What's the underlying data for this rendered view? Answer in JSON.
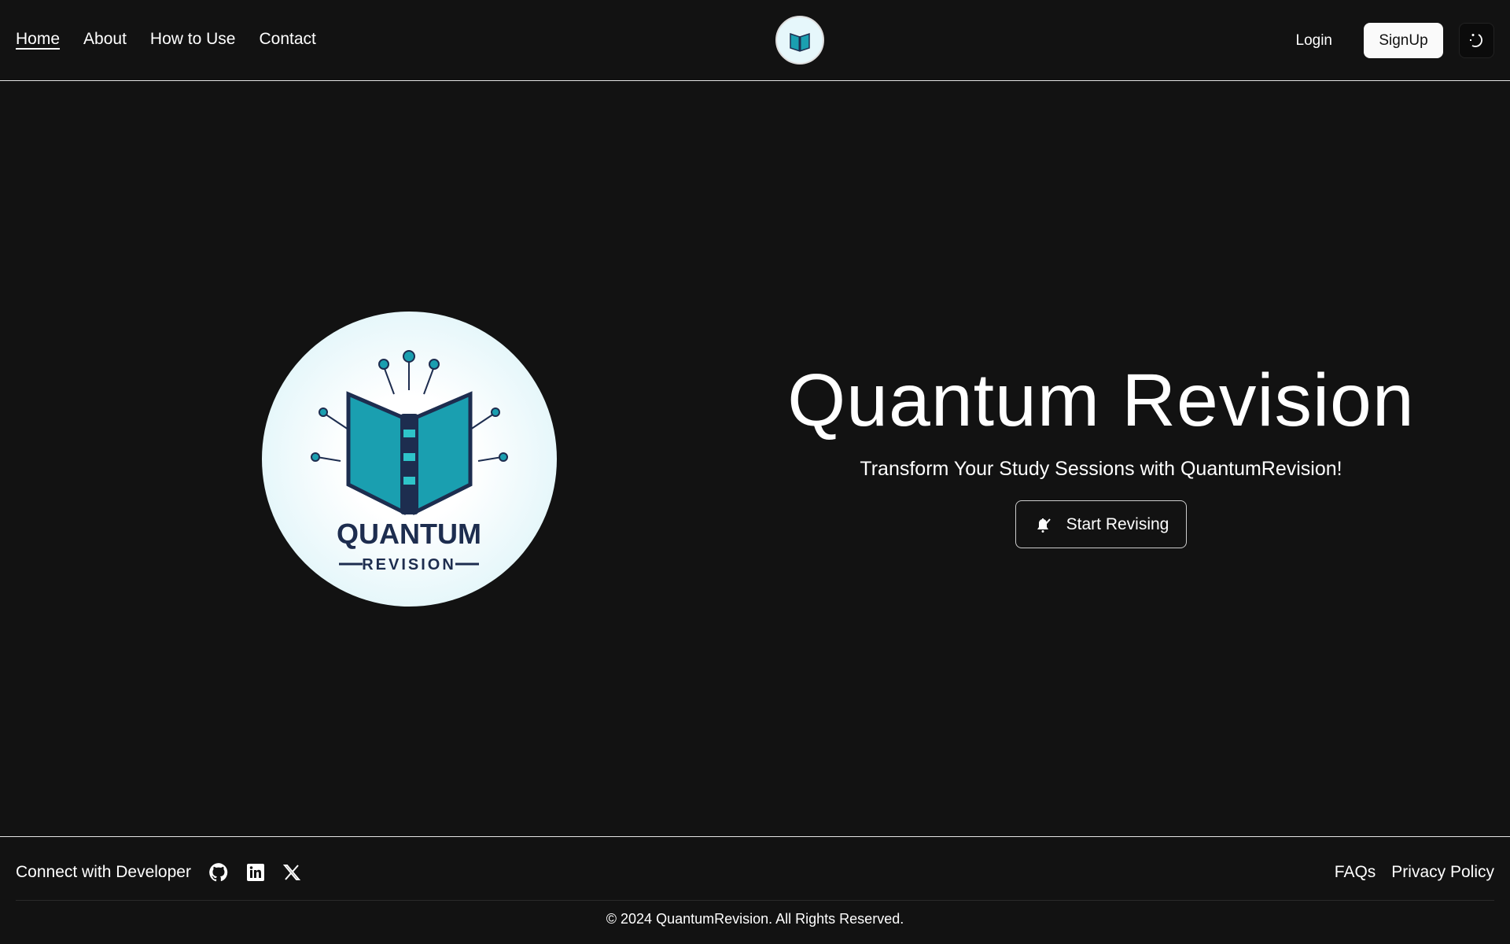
{
  "nav": {
    "links": [
      "Home",
      "About",
      "How to Use",
      "Contact"
    ],
    "active": "Home",
    "login": "Login",
    "signup": "SignUp",
    "theme_icon": "moon-stars-icon"
  },
  "hero": {
    "logo_text_1": "QUANTUM",
    "logo_text_2": "REVISION",
    "title": "Quantum Revision",
    "subtitle": "Transform Your Study Sessions with QuantumRevision!",
    "cta": "Start Revising",
    "cta_icon": "bell-pencil-icon"
  },
  "footer": {
    "connect": "Connect with Developer",
    "social": [
      "github-icon",
      "linkedin-icon",
      "x-icon"
    ],
    "links": [
      "FAQs",
      "Privacy Policy"
    ],
    "copyright": "© 2024 QuantumRevision. All Rights Reserved."
  },
  "colors": {
    "background": "#121212",
    "book_teal": "#1a9fb0",
    "book_navy": "#1d2d4f"
  }
}
